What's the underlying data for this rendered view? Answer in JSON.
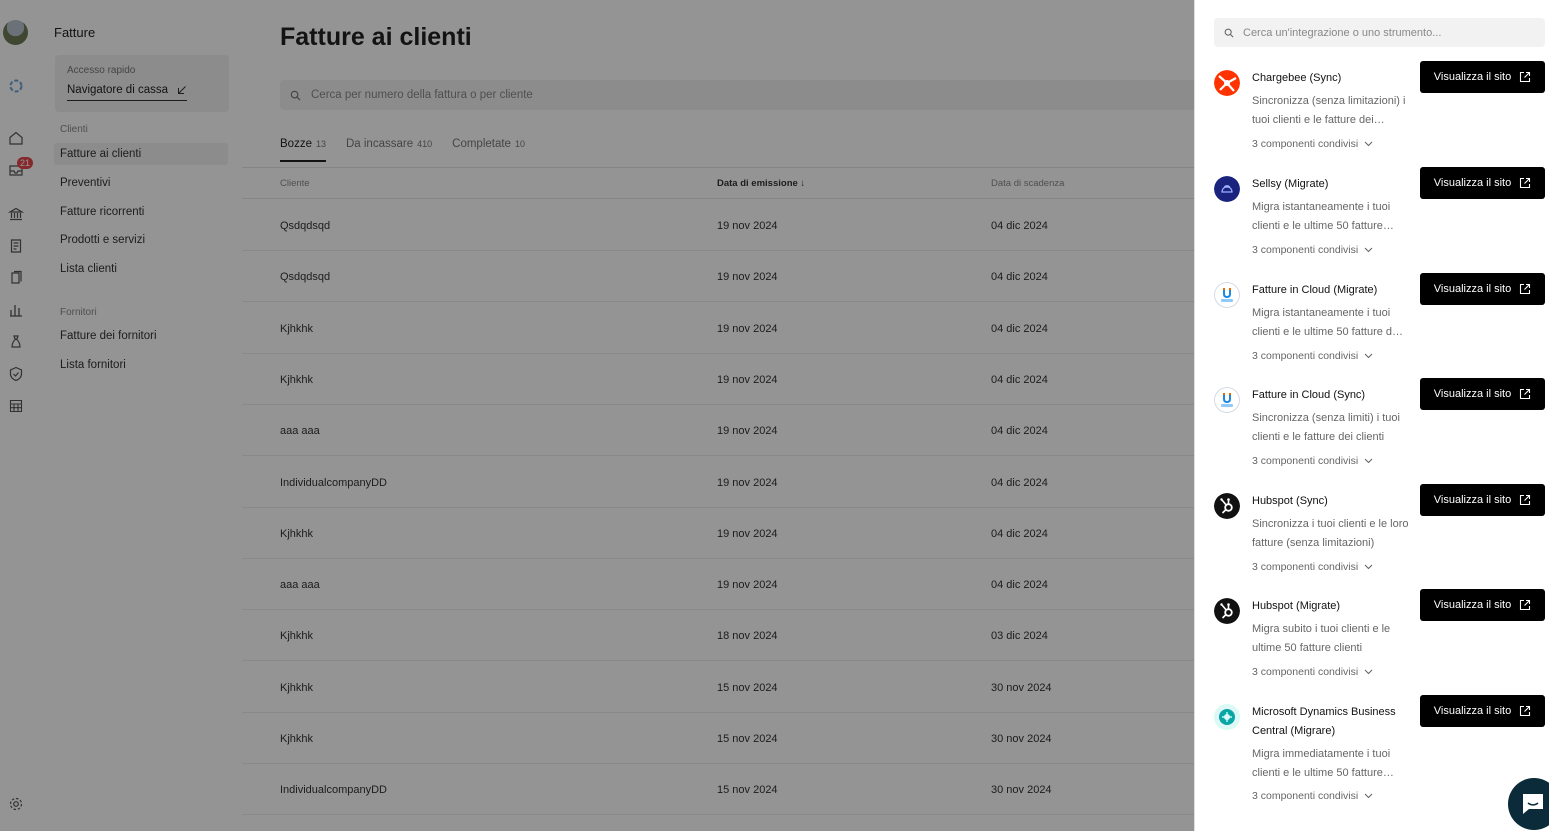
{
  "app": {
    "title": "Fatture",
    "notification_count": "21"
  },
  "rail": {
    "icons": [
      "home-icon",
      "inbox-icon",
      "bank-icon",
      "invoice-icon",
      "documents-icon",
      "chart-icon",
      "money-bag-icon",
      "shield-icon",
      "calculator-icon",
      "settings-icon"
    ]
  },
  "quick_access": {
    "label": "Accesso rapido",
    "link": "Navigatore di cassa"
  },
  "nav": {
    "clients_section": "Clienti",
    "clients_items": [
      "Fatture ai clienti",
      "Preventivi",
      "Fatture ricorrenti",
      "Prodotti e servizi",
      "Lista clienti"
    ],
    "suppliers_section": "Fornitori",
    "suppliers_items": [
      "Fatture dei fornitori",
      "Lista fornitori"
    ]
  },
  "main": {
    "title": "Fatture ai clienti",
    "search_placeholder": "Cerca per numero della fattura o per cliente",
    "tabs": [
      {
        "label": "Bozze",
        "count": "13"
      },
      {
        "label": "Da incassare",
        "count": "410"
      },
      {
        "label": "Completate",
        "count": "10"
      }
    ],
    "columns": {
      "client": "Cliente",
      "issue_date": "Data di emissione",
      "due_date": "Data di scadenza"
    },
    "rows": [
      {
        "client": "Qsdqdsqd",
        "issue": "19 nov 2024",
        "due": "04 dic 2024"
      },
      {
        "client": "Qsdqdsqd",
        "issue": "19 nov 2024",
        "due": "04 dic 2024"
      },
      {
        "client": "Kjhkhk",
        "issue": "19 nov 2024",
        "due": "04 dic 2024"
      },
      {
        "client": "Kjhkhk",
        "issue": "19 nov 2024",
        "due": "04 dic 2024"
      },
      {
        "client": "aaa aaa",
        "issue": "19 nov 2024",
        "due": "04 dic 2024"
      },
      {
        "client": "IndividualcompanyDD",
        "issue": "19 nov 2024",
        "due": "04 dic 2024"
      },
      {
        "client": "Kjhkhk",
        "issue": "19 nov 2024",
        "due": "04 dic 2024"
      },
      {
        "client": "aaa aaa",
        "issue": "19 nov 2024",
        "due": "04 dic 2024"
      },
      {
        "client": "Kjhkhk",
        "issue": "18 nov 2024",
        "due": "03 dic 2024"
      },
      {
        "client": "Kjhkhk",
        "issue": "15 nov 2024",
        "due": "30 nov 2024"
      },
      {
        "client": "Kjhkhk",
        "issue": "15 nov 2024",
        "due": "30 nov 2024"
      },
      {
        "client": "IndividualcompanyDD",
        "issue": "15 nov 2024",
        "due": "30 nov 2024"
      }
    ]
  },
  "drawer": {
    "search_placeholder": "Cerca un'integrazione o uno strumento...",
    "button_label": "Visualizza il sito",
    "integrations": [
      {
        "name": "Chargebee (Sync)",
        "desc": "Sincronizza (senza limitazioni) i tuoi clienti e le fatture dei…",
        "shared": "3 componenti condivisi",
        "logo": "chargebee-logo"
      },
      {
        "name": "Sellsy (Migrate)",
        "desc": "Migra istantaneamente i tuoi clienti e le ultime 50 fatture…",
        "shared": "3 componenti condivisi",
        "logo": "sellsy-logo"
      },
      {
        "name": "Fatture in Cloud (Migrate)",
        "desc": "Migra istantaneamente i tuoi clienti e le ultime 50 fatture d…",
        "shared": "3 componenti condivisi",
        "logo": "fatture-in-cloud-logo"
      },
      {
        "name": "Fatture in Cloud (Sync)",
        "desc": "Sincronizza (senza limiti) i tuoi clienti e le fatture dei clienti",
        "shared": "3 componenti condivisi",
        "logo": "fatture-in-cloud-logo"
      },
      {
        "name": "Hubspot (Sync)",
        "desc": "Sincronizza i tuoi clienti e le loro fatture (senza limitazioni)",
        "shared": "3 componenti condivisi",
        "logo": "hubspot-logo"
      },
      {
        "name": "Hubspot (Migrate)",
        "desc": "Migra subito i tuoi clienti e le ultime 50 fatture clienti",
        "shared": "3 componenti condivisi",
        "logo": "hubspot-logo"
      },
      {
        "name": "Microsoft Dynamics Business Central (Migrare)",
        "desc": "Migra immediatamente i tuoi clienti e le ultime 50 fatture…",
        "shared": "3 componenti condivisi",
        "logo": "microsoft-dynamics-logo"
      }
    ]
  }
}
